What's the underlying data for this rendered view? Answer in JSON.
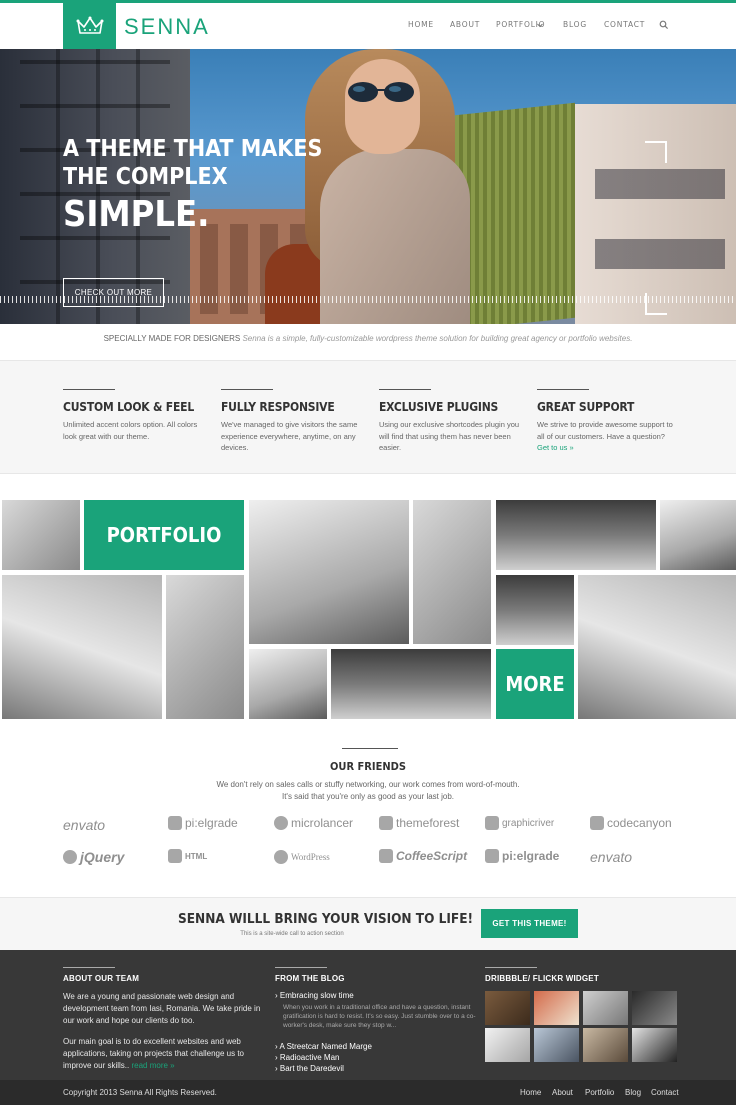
{
  "brand": {
    "name": "SENNA",
    "accent": "#1aa37a",
    "logo_icon": "crown-icon"
  },
  "nav": {
    "items": [
      {
        "label": "HOME"
      },
      {
        "label": "ABOUT"
      },
      {
        "label": "PORTFOLIO"
      },
      {
        "label": "BLOG"
      },
      {
        "label": "CONTACT"
      }
    ],
    "portfolio_icon": "chevron-down-icon",
    "search_icon": "search-icon"
  },
  "hero": {
    "line1": "A THEME THAT MAKES",
    "line2": "THE COMPLEX",
    "line3": "SIMPLE.",
    "button": "CHECK OUT MORE"
  },
  "tagline": {
    "lead": "SPECIALLY MADE FOR DESIGNERS",
    "rest": "Senna is a simple, fully-customizable wordpress theme solution for building great agency or portfolio websites."
  },
  "features": [
    {
      "title": "CUSTOM LOOK & FEEL",
      "text": "Unlimited accent colors option. All colors look great with our theme.",
      "link": ""
    },
    {
      "title": "FULLY RESPONSIVE",
      "text": "We've managed to give visitors the same experience everywhere, anytime, on any devices.",
      "link": ""
    },
    {
      "title": "EXCLUSIVE PLUGINS",
      "text": "Using our exclusive shortcodes plugin you will find that using them has never been easier.",
      "link": ""
    },
    {
      "title": "GREAT SUPPORT",
      "text": "We strive to provide awesome support to all of our customers. Have a question?",
      "link": "Get to us »"
    }
  ],
  "portfolio": {
    "portfolio_label": "PORTFOLIO",
    "more_label": "MORE"
  },
  "friends": {
    "title": "OUR FRIENDS",
    "subtitle_1": "We don't rely on sales calls or stuffy networking, our work comes from word-of-mouth.",
    "subtitle_2": "It's said that you're only as good as your last job.",
    "row1": [
      "envato",
      "pi:elgrade",
      "microlancer",
      "themeforest",
      "graphicriver",
      "codecanyon"
    ],
    "row2": [
      "jQuery",
      "HTML",
      "WordPress",
      "CoffeeScript",
      "pi:elgrade",
      "envato"
    ]
  },
  "cta": {
    "title": "SENNA WILLL BRING YOUR VISION TO LIFE!",
    "subtitle": "This is a site-wide call to action section",
    "button": "GET THIS THEME!"
  },
  "footer": {
    "about": {
      "title": "ABOUT OUR TEAM",
      "p1": "We are a young and passionate web design and development team from Iasi, Romania. We take pride in our work and hope our clients do too.",
      "p2": "Our main goal is to do excellent websites and web applications, taking on projects that challenge us to improve our skills..",
      "more": "read more »"
    },
    "blog": {
      "title": "FROM THE BLOG",
      "first": "Embracing slow time",
      "excerpt": "When you work in a traditional office and have a question, instant gratification is hard to resist. It's so easy. Just stumble over to a co-worker's desk, make sure they stop w...",
      "items": [
        "A Streetcar Named Marge",
        "Radioactive Man",
        "Bart the Daredevil"
      ]
    },
    "flickr": {
      "title": "DRIBBBLE/ FLICKR WIDGET"
    }
  },
  "bottom": {
    "copyright": "Copyright 2013 Senna All Rights Reserved.",
    "links": [
      "Home",
      "About",
      "Portfolio",
      "Blog",
      "Contact"
    ]
  }
}
